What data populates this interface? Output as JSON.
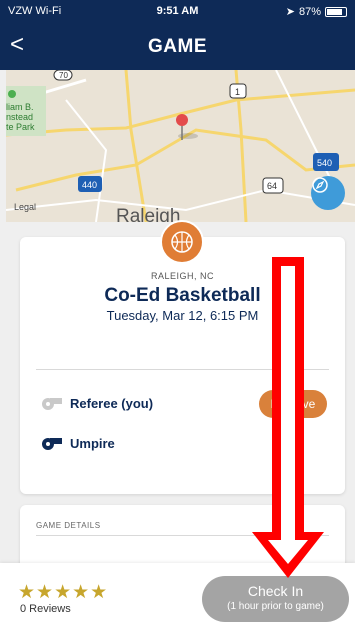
{
  "status_bar": {
    "carrier": "VZW Wi-Fi",
    "time": "9:51 AM",
    "battery": "87%"
  },
  "header": {
    "title": "GAME",
    "back_glyph": "<"
  },
  "map": {
    "legal": "Legal",
    "labels": [
      "70",
      "1",
      "540",
      "440",
      "64",
      "liam B.",
      "nstead",
      "te Park",
      "Raleigh"
    ]
  },
  "game": {
    "location": "RALEIGH, NC",
    "name": "Co-Ed Basketball",
    "date": "Tuesday, Mar 12, 6:15 PM",
    "roles": [
      {
        "label": "Referee (you)",
        "icon": "whistle-icon"
      },
      {
        "label": "Umpire",
        "icon": "whistle-icon"
      }
    ],
    "remove_label": "Remove"
  },
  "details": {
    "label": "GAME DETAILS"
  },
  "footer": {
    "stars": "★★★★★",
    "reviews": "0 Reviews",
    "checkin_label": "Check In",
    "checkin_sub": "(1 hour prior to game)"
  },
  "colors": {
    "navy": "#0e2a57",
    "orange": "#e07d35",
    "gold": "#c7a62d",
    "annotation_red": "#ff0000"
  }
}
